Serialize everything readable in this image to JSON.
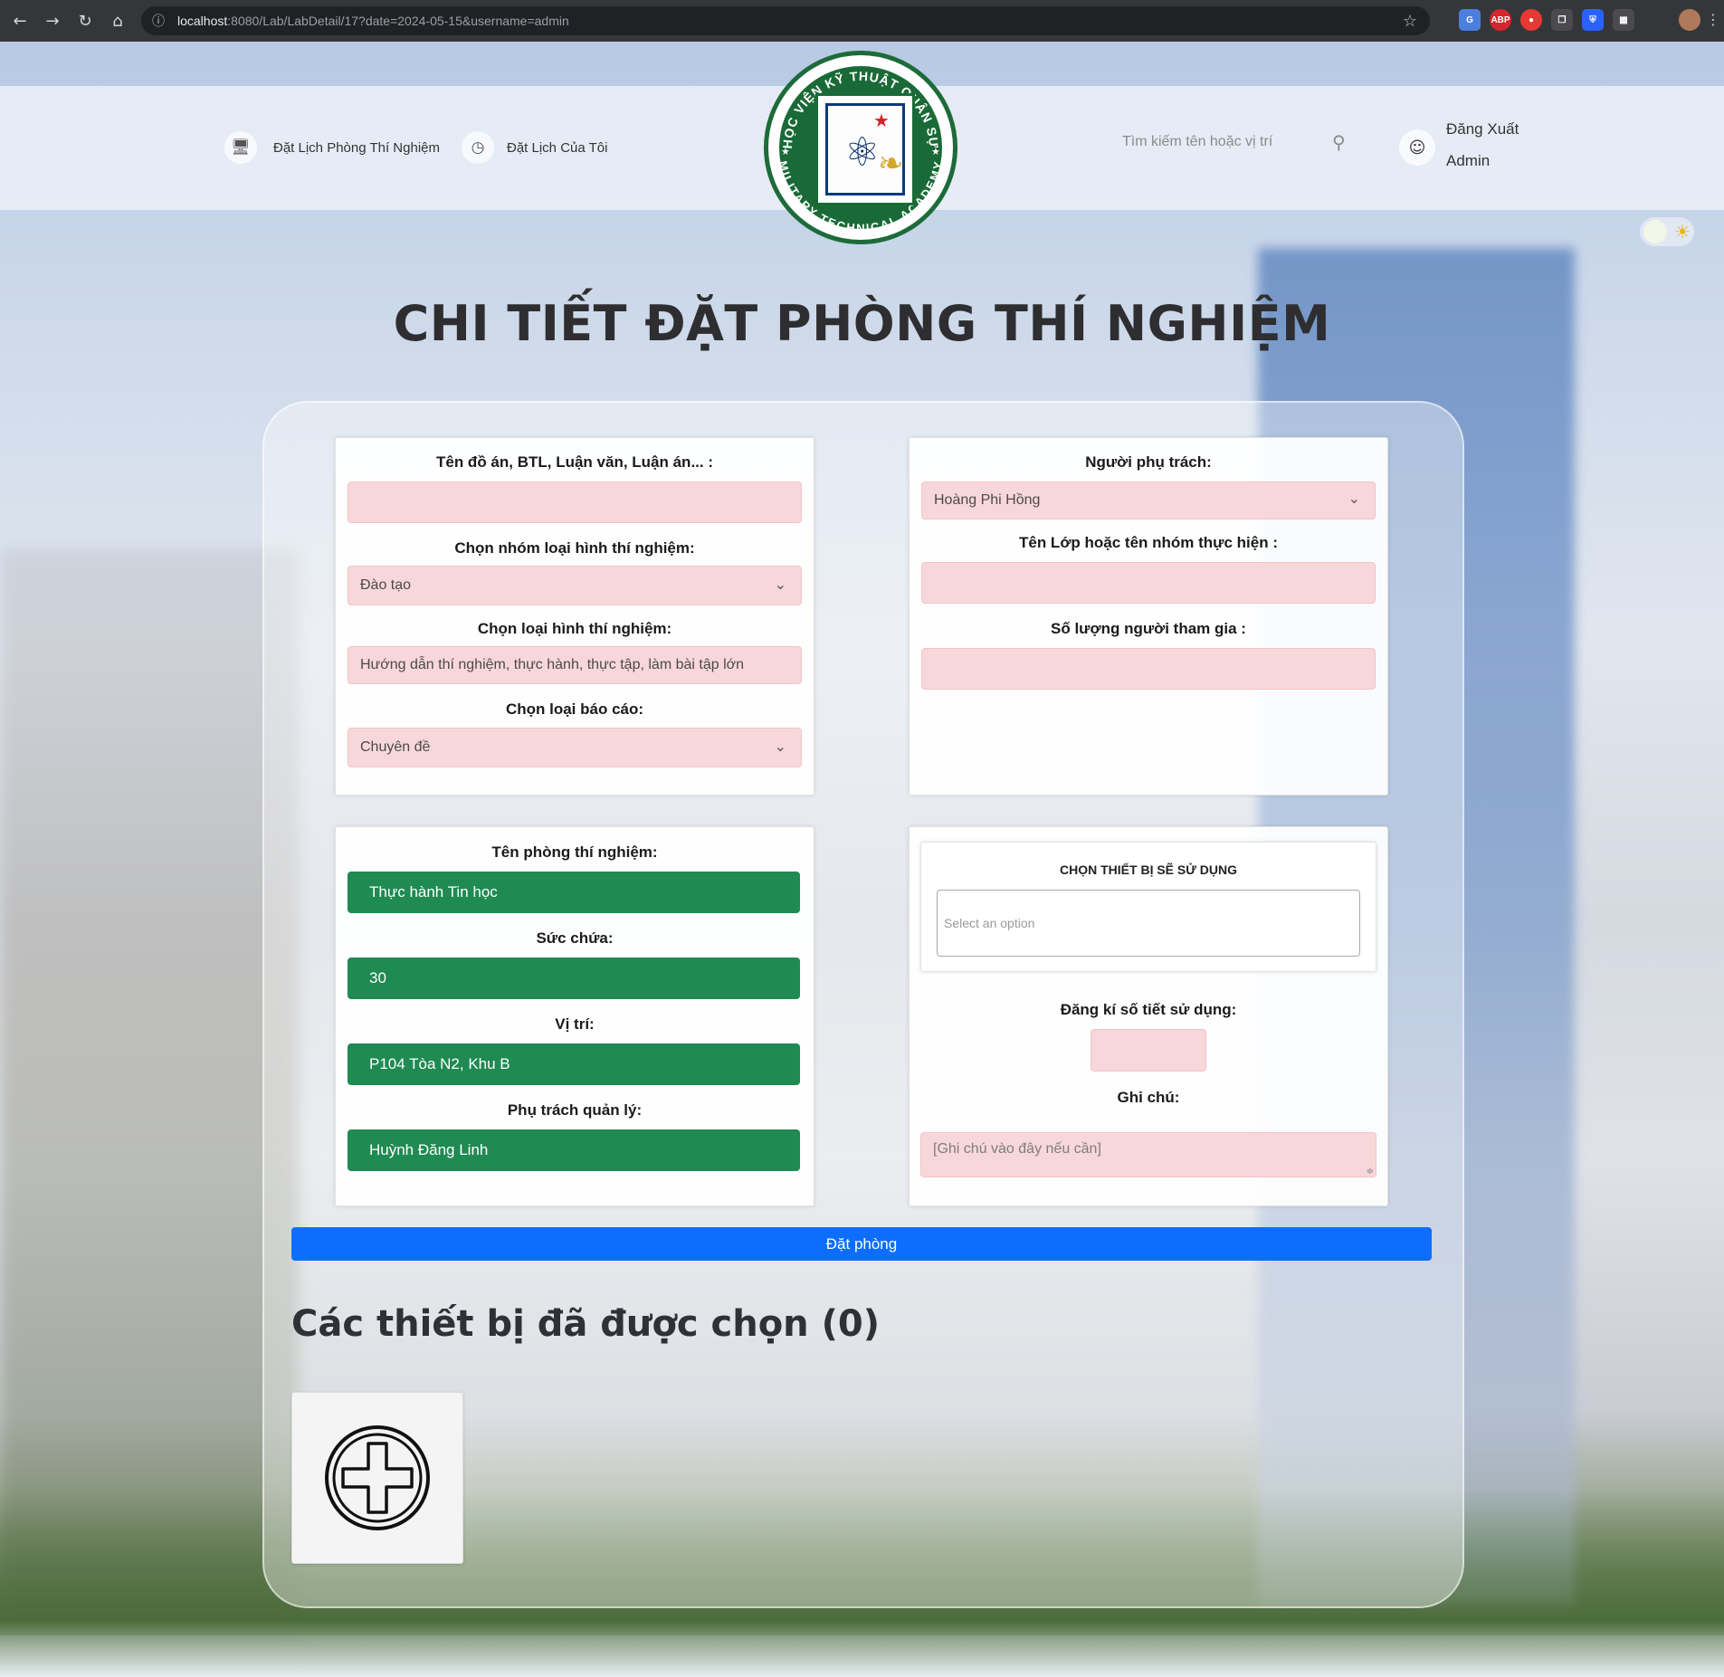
{
  "browser": {
    "url_host": "localhost",
    "url_rest": ":8080/Lab/LabDetail/17?date=2024-05-15&username=admin"
  },
  "header": {
    "nav_book_lab": "Đặt Lịch Phòng Thí Nghiệm",
    "nav_my_schedule": "Đặt Lịch Của Tôi",
    "search_placeholder": "Tìm kiếm tên hoặc vị trí",
    "logout_label": "Đăng Xuất",
    "username": "Admin",
    "logo": {
      "top_text": "HỌC VIỆN KỸ THUẬT QUÂN SỰ",
      "bottom_text": "MILITARY TECHNICAL ACADEMY"
    }
  },
  "page": {
    "title": "CHI TIẾT ĐẶT PHÒNG THÍ NGHIỆM"
  },
  "project_form": {
    "project_name_label": "Tên đồ án, BTL, Luận văn, Luận án... :",
    "project_name_value": "",
    "experiment_group_label": "Chọn nhóm loại hình thí nghiệm:",
    "experiment_group_value": "Đào tạo",
    "experiment_type_label": "Chọn loại hình thí nghiệm:",
    "experiment_type_value": "Hướng dẫn thí nghiệm, thực hành, thực tập, làm bài tập lớn",
    "report_type_label": "Chọn loại báo cáo:",
    "report_type_value": "Chuyên đề"
  },
  "people_form": {
    "supervisor_label": "Người phụ trách:",
    "supervisor_value": "Hoàng Phi Hồng",
    "class_label": "Tên Lớp hoặc tên nhóm thực hiện :",
    "class_value": "",
    "participants_label": "Số lượng người tham gia :",
    "participants_value": ""
  },
  "lab_info": {
    "lab_name_label": "Tên phòng thí nghiệm:",
    "lab_name_value": "Thực hành Tin học",
    "capacity_label": "Sức chứa:",
    "capacity_value": "30",
    "location_label": "Vị trí:",
    "location_value": "P104 Tòa N2, Khu B",
    "manager_label": "Phụ trách quản lý:",
    "manager_value": "Huỳnh Đăng Linh"
  },
  "device_form": {
    "devices_label": "CHỌN THIẾT BỊ SẼ SỬ DỤNG",
    "devices_placeholder": "Select an option",
    "periods_label": "Đăng kí số tiết sử dụng:",
    "periods_value": "",
    "note_label": "Ghi chú:",
    "note_placeholder": "[Ghi chú vào đây nếu cần]"
  },
  "actions": {
    "book_button": "Đặt phòng"
  },
  "selected_devices": {
    "title": "Các thiết bị đã được chọn (0)"
  },
  "colors": {
    "accent_blue": "#0d6efd",
    "lab_green": "#1f8a52",
    "field_pink": "#f8d7da",
    "logo_green": "#1a6a37"
  }
}
